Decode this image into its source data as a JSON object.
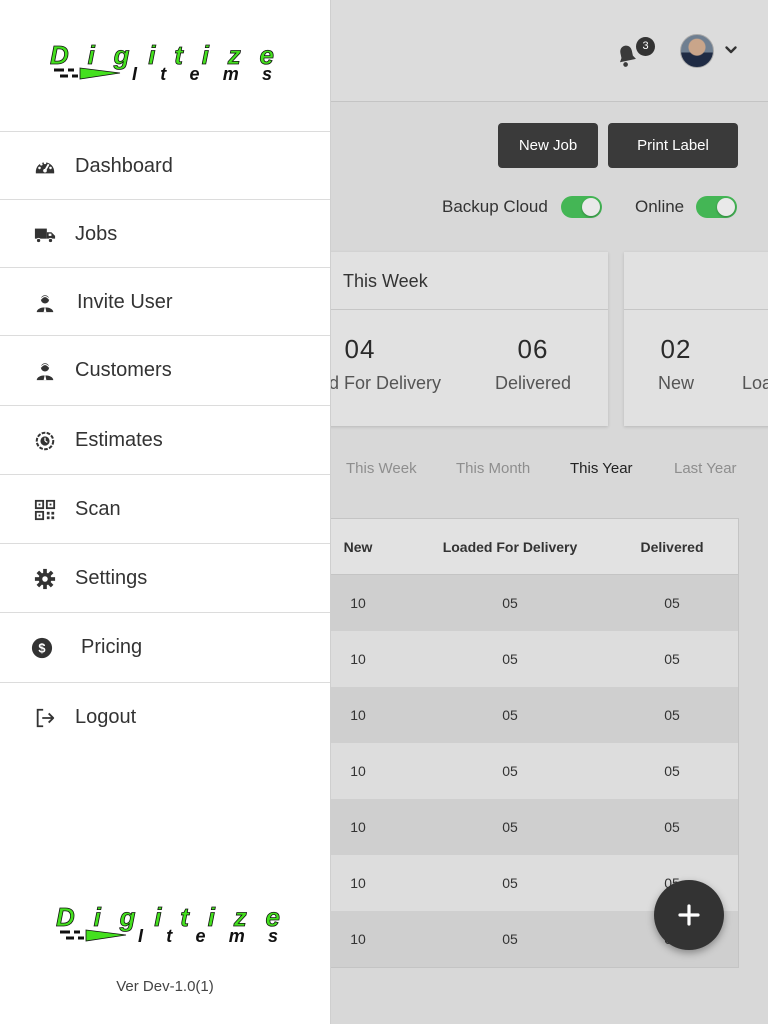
{
  "header": {
    "notification_count": "3",
    "new_job_label": "New Job",
    "print_label_label": "Print Label",
    "backup_cloud_label": "Backup Cloud",
    "backup_cloud_on": true,
    "online_label": "Online",
    "online_on": true,
    "accent_color": "#44b655"
  },
  "cards": [
    {
      "title": "This Week",
      "stats": [
        {
          "value": "04",
          "label": "Loaded For Delivery"
        },
        {
          "value": "06",
          "label": "Delivered"
        }
      ]
    },
    {
      "title": "",
      "stats": [
        {
          "value": "02",
          "label": "New"
        },
        {
          "value": "",
          "label": "Loa"
        }
      ]
    }
  ],
  "periods": [
    "This Week",
    "This Month",
    "This Year",
    "Last Year"
  ],
  "active_period": "This Year",
  "table": {
    "columns": [
      "New",
      "Loaded For Delivery",
      "Delivered"
    ],
    "rows": [
      [
        "10",
        "05",
        "05"
      ],
      [
        "10",
        "05",
        "05"
      ],
      [
        "10",
        "05",
        "05"
      ],
      [
        "10",
        "05",
        "05"
      ],
      [
        "10",
        "05",
        "05"
      ],
      [
        "10",
        "05",
        "05"
      ],
      [
        "10",
        "05",
        "05"
      ]
    ]
  },
  "drawer": {
    "brand": {
      "line1": "Digitize",
      "line2": "Items"
    },
    "menu": [
      {
        "label": "Dashboard",
        "icon": "dashboard-icon"
      },
      {
        "label": "Jobs",
        "icon": "truck-icon"
      },
      {
        "label": "Invite User",
        "icon": "user-icon"
      },
      {
        "label": "Customers",
        "icon": "user-icon"
      },
      {
        "label": "Estimates",
        "icon": "estimate-icon"
      },
      {
        "label": "Scan",
        "icon": "qr-code-icon"
      },
      {
        "label": "Settings",
        "icon": "gear-icon"
      },
      {
        "label": "Pricing",
        "icon": "dollar-icon"
      },
      {
        "label": "Logout",
        "icon": "logout-icon"
      }
    ],
    "version": "Ver Dev-1.0(1)"
  }
}
